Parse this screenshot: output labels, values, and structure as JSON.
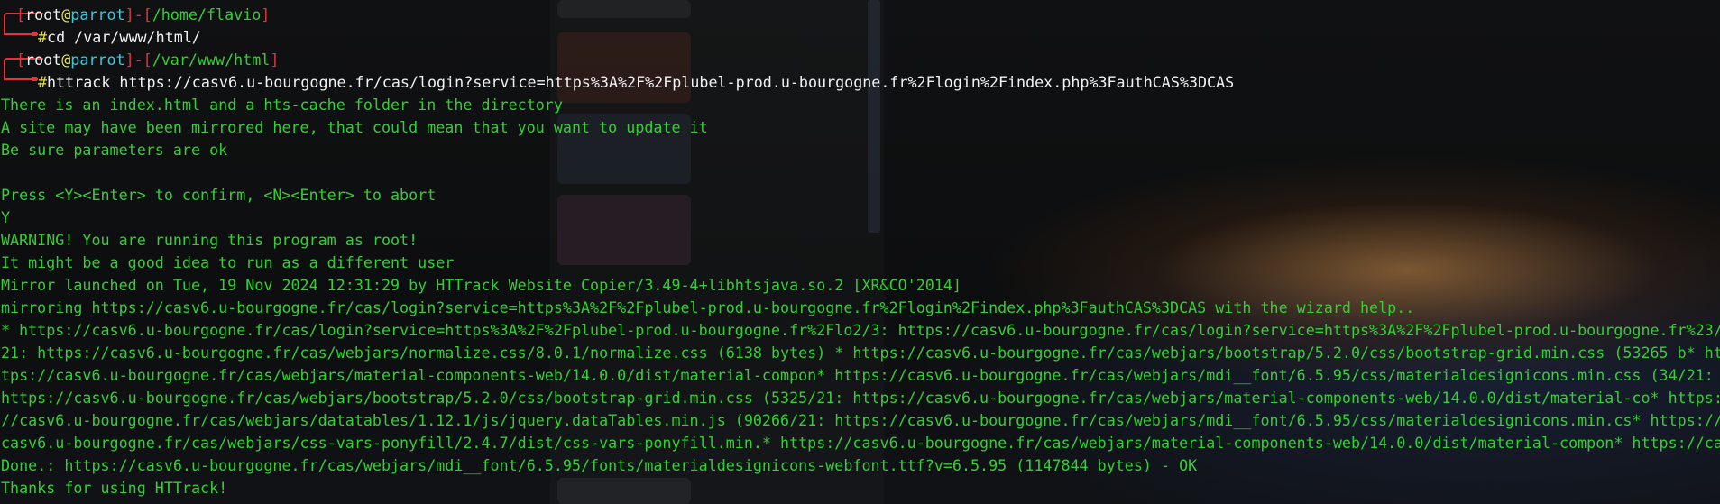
{
  "prompt1": {
    "user": "root",
    "at": "@",
    "host": "parrot",
    "path": "/home/flavio",
    "hash": "#",
    "command": "cd /var/www/html/"
  },
  "prompt2": {
    "user": "root",
    "at": "@",
    "host": "parrot",
    "path": "/var/www/html",
    "hash": "#",
    "command": "httrack https://casv6.u-bourgogne.fr/cas/login?service=https%3A%2F%2Fplubel-prod.u-bourgogne.fr%2Flogin%2Findex.php%3FauthCAS%3DCAS"
  },
  "output": [
    "There is an index.html and a hts-cache folder in the directory",
    "A site may have been mirrored here, that could mean that you want to update it",
    "Be sure parameters are ok",
    "",
    "Press <Y><Enter> to confirm, <N><Enter> to abort",
    "Y",
    "WARNING! You are running this program as root!",
    "It might be a good idea to run as a different user",
    "Mirror launched on Tue, 19 Nov 2024 12:31:29 by HTTrack Website Copier/3.49-4+libhtsjava.so.2 [XR&CO'2014]",
    "mirroring https://casv6.u-bourgogne.fr/cas/login?service=https%3A%2F%2Fplubel-prod.u-bourgogne.fr%2Flogin%2Findex.php%3FauthCAS%3DCAS with the wizard help..",
    "* https://casv6.u-bourgogne.fr/cas/login?service=https%3A%2F%2Fplubel-prod.u-bourgogne.fr%2Flo2/3: https://casv6.u-bourgogne.fr/cas/login?service=https%3A%2F%2Fplubel-prod.u-bourgogne.fr%23/",
    "21: https://casv6.u-bourgogne.fr/cas/webjars/normalize.css/8.0.1/normalize.css (6138 bytes) * https://casv6.u-bourgogne.fr/cas/webjars/bootstrap/5.2.0/css/bootstrap-grid.min.css (53265 b* ht",
    "tps://casv6.u-bourgogne.fr/cas/webjars/material-components-web/14.0.0/dist/material-compon* https://casv6.u-bourgogne.fr/cas/webjars/mdi__font/6.5.95/css/materialdesignicons.min.css (34/21:",
    "https://casv6.u-bourgogne.fr/cas/webjars/bootstrap/5.2.0/css/bootstrap-grid.min.css (5325/21: https://casv6.u-bourgogne.fr/cas/webjars/material-components-web/14.0.0/dist/material-co* https:",
    "//casv6.u-bourgogne.fr/cas/webjars/datatables/1.12.1/js/jquery.dataTables.min.js (90266/21: https://casv6.u-bourgogne.fr/cas/webjars/mdi__font/6.5.95/css/materialdesignicons.min.cs* https://",
    "casv6.u-bourgogne.fr/cas/webjars/css-vars-ponyfill/2.4.7/dist/css-vars-ponyfill.min.* https://casv6.u-bourgogne.fr/cas/webjars/material-components-web/14.0.0/dist/material-compon* https://ca",
    "Done.: https://casv6.u-bourgogne.fr/cas/webjars/mdi__font/6.5.95/fonts/materialdesignicons-webfont.ttf?v=6.5.95 (1147844 bytes) - OK",
    "Thanks for using HTTrack!"
  ],
  "colors": {
    "prompt_red": "#e0343a",
    "user_white": "#f2f2f2",
    "host_cyan": "#3fc7d9",
    "hash_yellow": "#e3e156",
    "output_green": "#31d131"
  }
}
